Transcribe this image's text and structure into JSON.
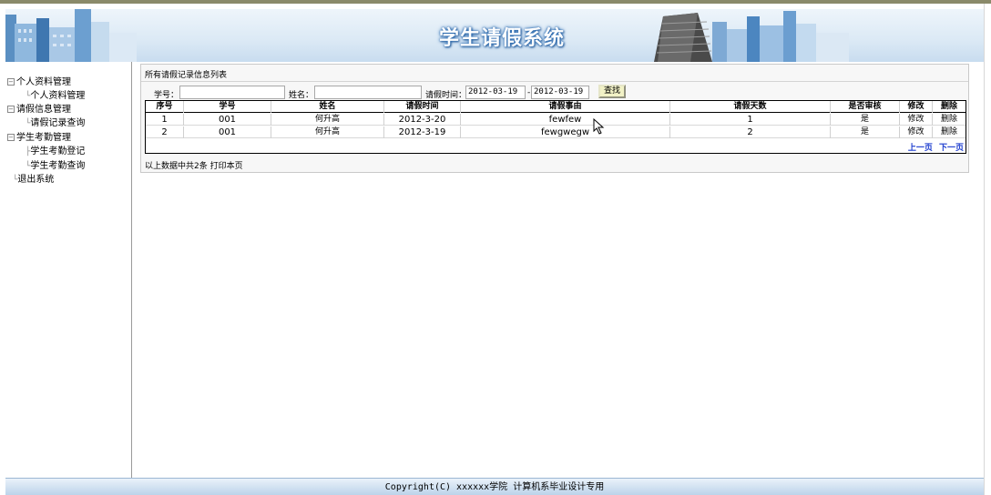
{
  "header": {
    "title": "学生请假系统"
  },
  "sidebar": {
    "items": [
      {
        "label": "个人资料管理"
      },
      {
        "label": "个人资料管理"
      },
      {
        "label": "请假信息管理"
      },
      {
        "label": "请假记录查询"
      },
      {
        "label": "学生考勤管理"
      },
      {
        "label": "学生考勤登记"
      },
      {
        "label": "学生考勤查询"
      },
      {
        "label": "退出系统"
      }
    ]
  },
  "panel": {
    "title": "所有请假记录信息列表"
  },
  "search": {
    "student_id_label": "学号：",
    "student_id_value": "",
    "name_label": "姓名：",
    "name_value": "",
    "time_label": "请假时间：",
    "date_from": "2012-03-19",
    "date_to": "2012-03-19",
    "button_label": "查找"
  },
  "table": {
    "headers": [
      "序号",
      "学号",
      "姓名",
      "请假时间",
      "请假事由",
      "请假天数",
      "是否审核",
      "修改",
      "删除"
    ],
    "rows": [
      [
        "1",
        "001",
        "何升高",
        "2012-3-20",
        "fewfew",
        "1",
        "是",
        "修改",
        "删除"
      ],
      [
        "2",
        "001",
        "何升高",
        "2012-3-19",
        "fewgwegw",
        "2",
        "是",
        "修改",
        "删除"
      ]
    ]
  },
  "pager": {
    "prev": "上一页",
    "next": "下一页"
  },
  "summary": "以上数据中共2条 打印本页",
  "footer": "Copyright(C) xxxxxx学院 计算机系毕业设计专用"
}
